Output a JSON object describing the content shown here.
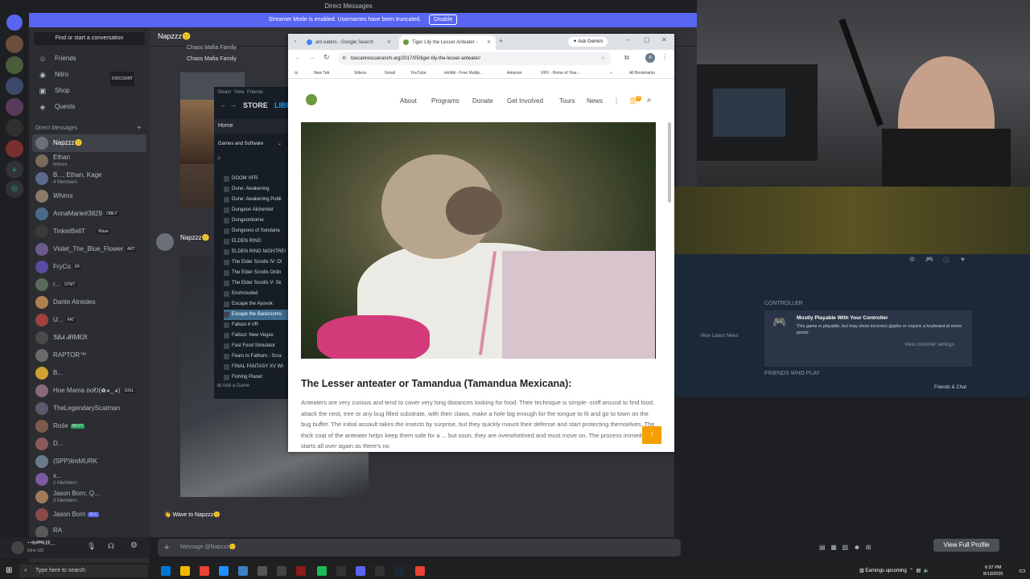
{
  "discord": {
    "window_title": "Direct Messages",
    "streamer_banner": "Streamer Mode is enabled. Usernames have been truncated.",
    "streamer_disable": "Disable",
    "find_conversation": "Find or start a conversation",
    "nav": [
      {
        "label": "Friends",
        "icon": "friends-icon"
      },
      {
        "label": "Nitro",
        "icon": "nitro-icon",
        "badge": "DISCOUNT"
      },
      {
        "label": "Shop",
        "icon": "shop-icon"
      },
      {
        "label": "Quests",
        "icon": "quests-icon"
      }
    ],
    "dm_header": "Direct Messages",
    "dms": [
      {
        "name": "Napzzz🙂",
        "selected": true
      },
      {
        "name": "Ethan",
        "sub": "letmes"
      },
      {
        "name": "B..., Ethan, Kage",
        "sub": "4 Members"
      },
      {
        "name": "Whims"
      },
      {
        "name": "AnnaMarie#3829",
        "tag": "OBEY"
      },
      {
        "name": "TinkerBellT",
        "tag": "Wave"
      },
      {
        "name": "Violet_The_Blue_Flower",
        "tag": "ART"
      },
      {
        "name": "FryCo",
        "tag": "DF"
      },
      {
        "name": "r...",
        "tag": "STMT"
      },
      {
        "name": "Dante Atreides"
      },
      {
        "name": "U...",
        "tag": "FAT"
      },
      {
        "name": "ᏕᏰᏗ ᏗᏒᎷᏋᏒ"
      },
      {
        "name": "RAPTOR™"
      },
      {
        "name": "B..."
      },
      {
        "name": "Hoe Mama ɒoᎧ(✿◕‿◕)",
        "tag": "GIGL"
      },
      {
        "name": "TheLegendaryScatman"
      },
      {
        "name": "Rośe",
        "tag": "HEYY"
      },
      {
        "name": "D..."
      },
      {
        "name": "(SPP)limMURK"
      },
      {
        "name": "x...",
        "sub": "2 Members"
      },
      {
        "name": "Jason Born, Q...",
        "sub": "3 Members"
      },
      {
        "name": "Jason Born",
        "tag": "RLC"
      },
      {
        "name": "RA"
      }
    ],
    "user_name": "ᐩ⁺ᴮˢᴾᴾᴷᴸᴱᴱ...",
    "user_sub": "blink-182",
    "chat_header_name": "Napzzz🙂",
    "chat_recipient": "Napzzz🙂",
    "chat_family_1": "Chaos Mafia Family",
    "chat_family_2": "Chaos Mafia Family",
    "wave_text": "Wave to Napzzz🙂",
    "message_placeholder": "Message @Napzzz🙂",
    "view_full_profile": "View Full Profile"
  },
  "steam": {
    "menu": [
      "Steam",
      "View",
      "Friends"
    ],
    "nav_store": "STORE",
    "nav_library": "LIBR",
    "home": "Home",
    "games_filter": "Games and Software",
    "games": [
      "DOOM VFR",
      "Dune: Awakening",
      "Dune: Awakening Publi",
      "Dungeon Alchemist",
      "Dungeonborne",
      "Dungeons of Sundaria",
      "ELDEN RING",
      "ELDEN RING NIGHTREI",
      "The Elder Scrolls IV: Ol",
      "The Elder Scrolls Onlin",
      "The Elder Scrolls V: Sk",
      "Enshrouded",
      "Escape the Ayuvok",
      "Escape the Backrooms",
      "Fallout 4 VR",
      "Fallout: New Vegas",
      "Fast Food Simulator",
      "Fears to Fathom - Scra",
      "FINAL FANTASY XV WI",
      "Fishing Planet"
    ],
    "selected_game_index": 13,
    "add_game": "Add a Game",
    "controller_heading": "CONTROLLER",
    "controller_title": "Mostly Playable With Your Controller",
    "controller_desc": "This game is playable, but may show incorrect glyphs or require a keyboard at some points",
    "controller_link": "View controller settings",
    "view_latest_news": "View Latest News",
    "friends_who_play": "FRIENDS WHO PLAY",
    "friends_chat": "Friends & Chat"
  },
  "chrome": {
    "tabs": [
      {
        "title": "ant eaters - Google Search",
        "active": false
      },
      {
        "title": "Tiger Lily the Lesser Anteater -",
        "active": true
      }
    ],
    "ask_gemini": "Ask Gemini",
    "url": "toucanrescueranch.org/2017/05/tiger-lily-the-lesser-anteater/",
    "profile_initial": "A",
    "bookmarks": [
      "New Tab",
      "Videos",
      "Gmail",
      "YouTube",
      "skribbl - Free Multip...",
      "Amazon",
      "VRV - Home of Your..."
    ],
    "all_bookmarks": "All Bookmarks"
  },
  "site": {
    "nav": [
      "About",
      "Programs",
      "Donate",
      "Get Involved",
      "Tours",
      "News"
    ],
    "cart_count": "0",
    "heading": "The Lesser anteater or Tamandua (Tamandua Mexicana):",
    "paragraph": "Anteaters are very curious and tend to cover very long distances looking for food. Their technique is simple- sniff around to find food, attack the nest, tree or any bug filled substrate, with their claws, make a hole big enough for the tongue to fit and go to town on the bug buffet. The initial assault takes the insects by surprise, but they quickly mount their defense and start protecting themselves. The thick coat of the anteater helps keep them safe for a ... but soon, they are overwhelmed and must move on. The process immediately starts all over again as there's no"
  },
  "taskbar": {
    "search_placeholder": "Type here to search",
    "earnings": "Earnings upcoming",
    "time": "6:37 PM",
    "date": "8/13/2025"
  }
}
